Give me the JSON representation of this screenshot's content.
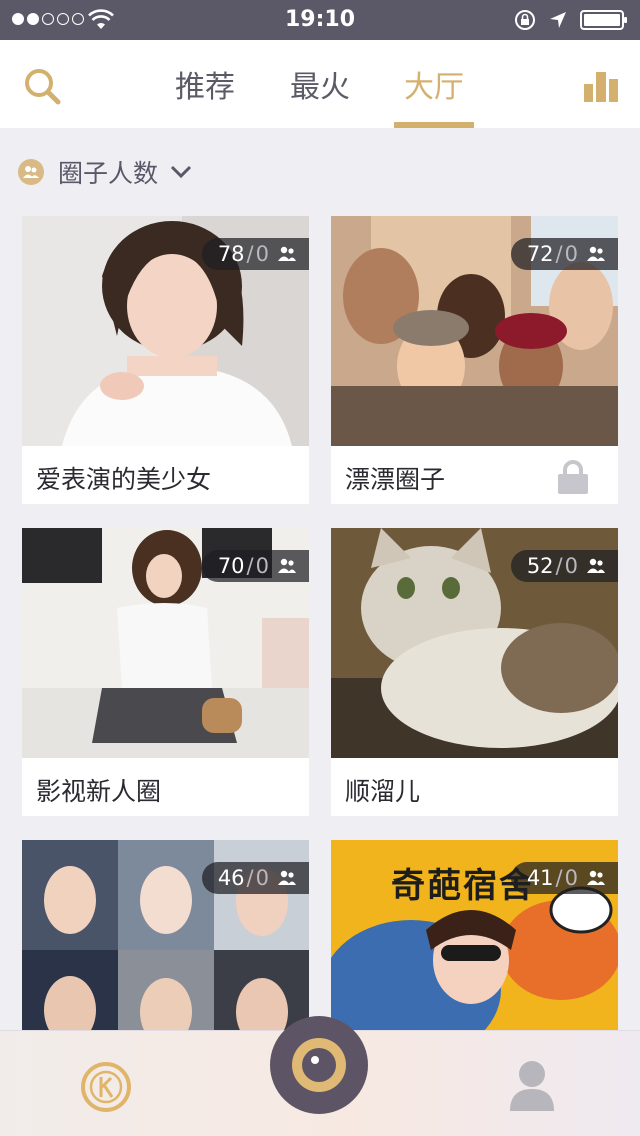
{
  "status_bar": {
    "time": "19:10",
    "signal_bars_filled": 2,
    "signal_bars_total": 5,
    "icons": [
      "signal-dots-icon",
      "wifi-icon",
      "rotation-lock-icon",
      "location-arrow-icon",
      "battery-icon"
    ]
  },
  "header": {
    "tabs": [
      {
        "label": "推荐",
        "active": false
      },
      {
        "label": "最火",
        "active": false
      },
      {
        "label": "大厅",
        "active": true
      }
    ],
    "left_icon": "search-icon",
    "right_icon": "ranking-chart-icon"
  },
  "filter": {
    "label": "圈子人数",
    "icon": "people-icon",
    "dropdown_icon": "chevron-down-icon"
  },
  "circles": [
    {
      "name": "爱表演的美少女",
      "count": "78",
      "online": "0",
      "locked": false,
      "image": "girl-portrait-photo"
    },
    {
      "name": "漂漂圈子",
      "count": "72",
      "online": "0",
      "locked": true,
      "image": "friends-group-selfie-photo"
    },
    {
      "name": "影视新人圈",
      "count": "70",
      "online": "0",
      "locked": false,
      "image": "girl-in-cafe-photo"
    },
    {
      "name": "顺溜儿",
      "count": "52",
      "online": "0",
      "locked": false,
      "image": "cat-photo"
    },
    {
      "name": "",
      "count": "46",
      "online": "0",
      "locked": false,
      "image": "male-idols-collage-photo"
    },
    {
      "name": "",
      "count": "41",
      "online": "0",
      "locked": false,
      "image": "comic-poster-girl-photo",
      "poster_text": "奇葩宿舍"
    }
  ],
  "bottom_bar": {
    "left_icon": "k-coin-icon",
    "center_icon": "camera-button-icon",
    "right_icon": "profile-icon"
  },
  "colors": {
    "accent": "#d4b06e",
    "status_bar": "#5b5868",
    "tab_inactive": "#5c5a67",
    "page_bg": "#efeef3"
  }
}
